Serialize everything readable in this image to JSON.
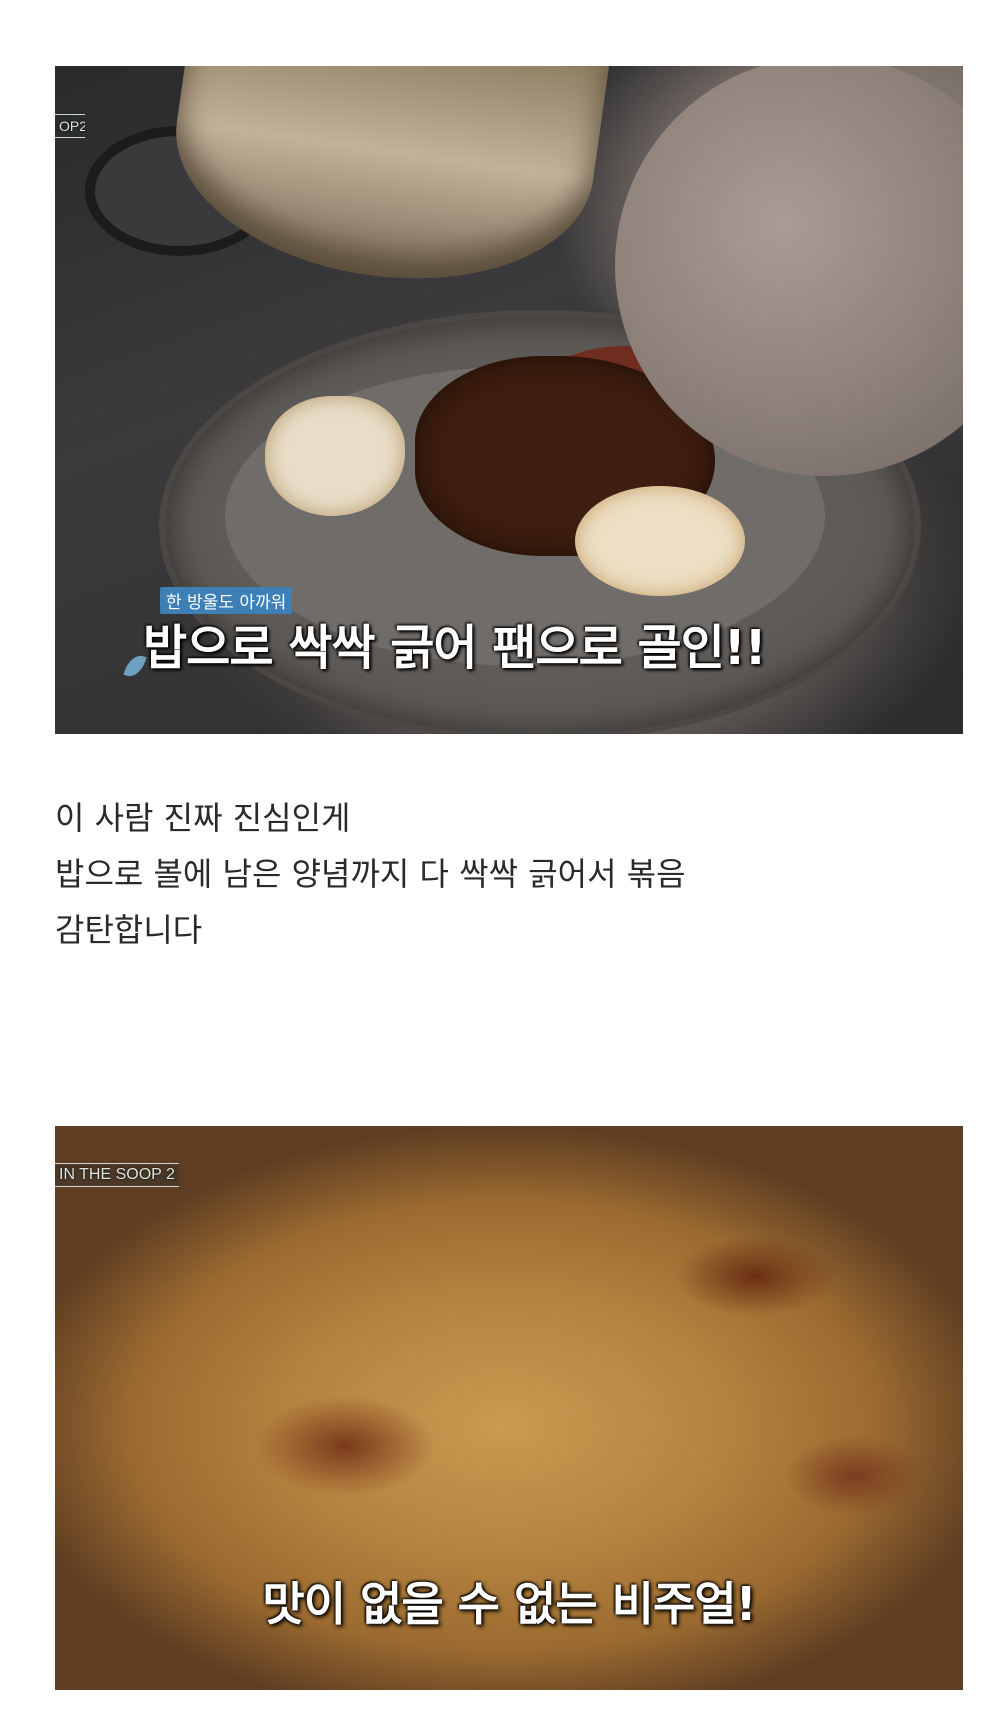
{
  "image1": {
    "logo_text": "OP2",
    "caption_small": "한 방울도 아까워",
    "caption_big": "밥으로 싹싹 긁어 팬으로 골인!!"
  },
  "body": {
    "lines": [
      "이 사람 진짜 진심인게",
      "밥으로 볼에 남은 양념까지 다 싹싹 긁어서 볶음",
      "감탄합니다"
    ]
  },
  "image2": {
    "logo_text": "IN THE SOOP 2",
    "caption": "맛이 없을 수 없는 비주얼!"
  }
}
